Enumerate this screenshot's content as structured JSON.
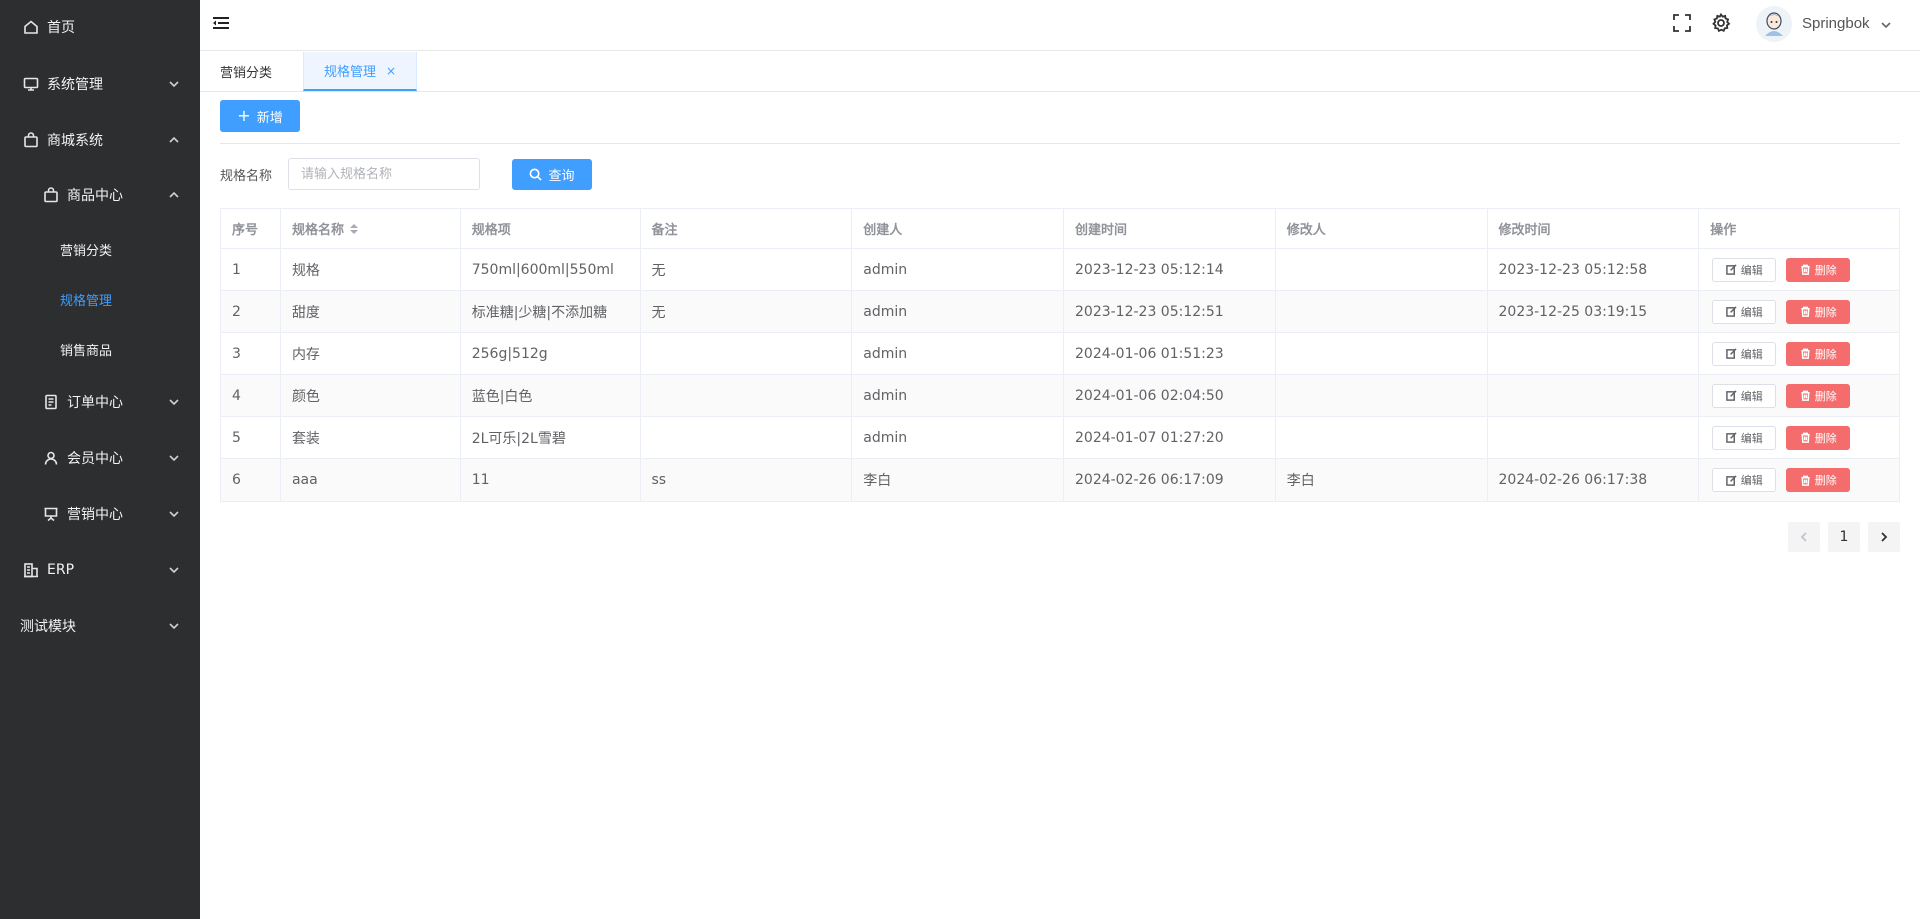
{
  "sidebar": {
    "items": [
      {
        "label": "首页"
      },
      {
        "label": "系统管理"
      },
      {
        "label": "商城系统"
      },
      {
        "label": "商品中心"
      },
      {
        "label": "营销分类"
      },
      {
        "label": "规格管理"
      },
      {
        "label": "销售商品"
      },
      {
        "label": "订单中心"
      },
      {
        "label": "会员中心"
      },
      {
        "label": "营销中心"
      },
      {
        "label": "ERP"
      },
      {
        "label": "测试模块"
      }
    ]
  },
  "header": {
    "username": "Springbok"
  },
  "tabs": [
    {
      "label": "营销分类"
    },
    {
      "label": "规格管理",
      "close": "×"
    }
  ],
  "toolbar": {
    "add_label": "新增"
  },
  "filter": {
    "label": "规格名称",
    "placeholder": "请输入规格名称",
    "query_label": "查询"
  },
  "table": {
    "columns": [
      "序号",
      "规格名称",
      "规格项",
      "备注",
      "创建人",
      "创建时间",
      "修改人",
      "修改时间",
      "操作"
    ],
    "edit_label": "编辑",
    "delete_label": "删除",
    "rows": [
      {
        "no": "1",
        "name": "规格",
        "items": "750ml|600ml|550ml",
        "remark": "无",
        "creator": "admin",
        "created": "2023-12-23 05:12:14",
        "modifier": "",
        "modified": "2023-12-23 05:12:58"
      },
      {
        "no": "2",
        "name": "甜度",
        "items": "标准糖|少糖|不添加糖",
        "remark": "无",
        "creator": "admin",
        "created": "2023-12-23 05:12:51",
        "modifier": "",
        "modified": "2023-12-25 03:19:15"
      },
      {
        "no": "3",
        "name": "内存",
        "items": "256g|512g",
        "remark": "",
        "creator": "admin",
        "created": "2024-01-06 01:51:23",
        "modifier": "",
        "modified": ""
      },
      {
        "no": "4",
        "name": "颜色",
        "items": "蓝色|白色",
        "remark": "",
        "creator": "admin",
        "created": "2024-01-06 02:04:50",
        "modifier": "",
        "modified": ""
      },
      {
        "no": "5",
        "name": "套装",
        "items": "2L可乐|2L雪碧",
        "remark": "",
        "creator": "admin",
        "created": "2024-01-07 01:27:20",
        "modifier": "",
        "modified": ""
      },
      {
        "no": "6",
        "name": "aaa",
        "items": "11",
        "remark": "ss",
        "creator": "李白",
        "created": "2024-02-26 06:17:09",
        "modifier": "李白",
        "modified": "2024-02-26 06:17:38"
      }
    ]
  },
  "pagination": {
    "current_page": "1"
  },
  "colors": {
    "sidebar_bg": "#2d2e30",
    "primary": "#409eff",
    "danger": "#f56c6c"
  }
}
